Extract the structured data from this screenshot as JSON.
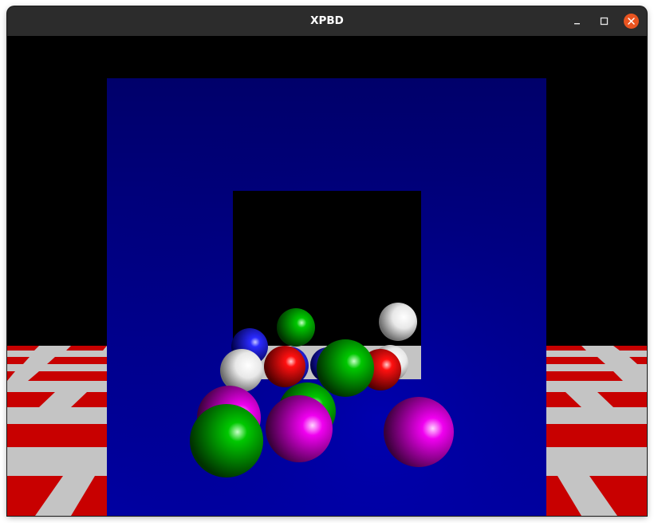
{
  "window": {
    "title": "XPBD"
  },
  "controls": {
    "minimize_icon": "minimize-icon",
    "maximize_icon": "maximize-icon",
    "close_icon": "close-icon",
    "close_color": "#e95420"
  },
  "scene": {
    "background_color": "#000000",
    "floor_colors": [
      "#cc0000",
      "#c8c8c8"
    ],
    "wall_color": "#0000a0",
    "sphere_colors": {
      "white": "#ffffff",
      "blue": "#0000ff",
      "green": "#00c000",
      "red": "#ff0000",
      "magenta": "#ff00ff"
    }
  }
}
